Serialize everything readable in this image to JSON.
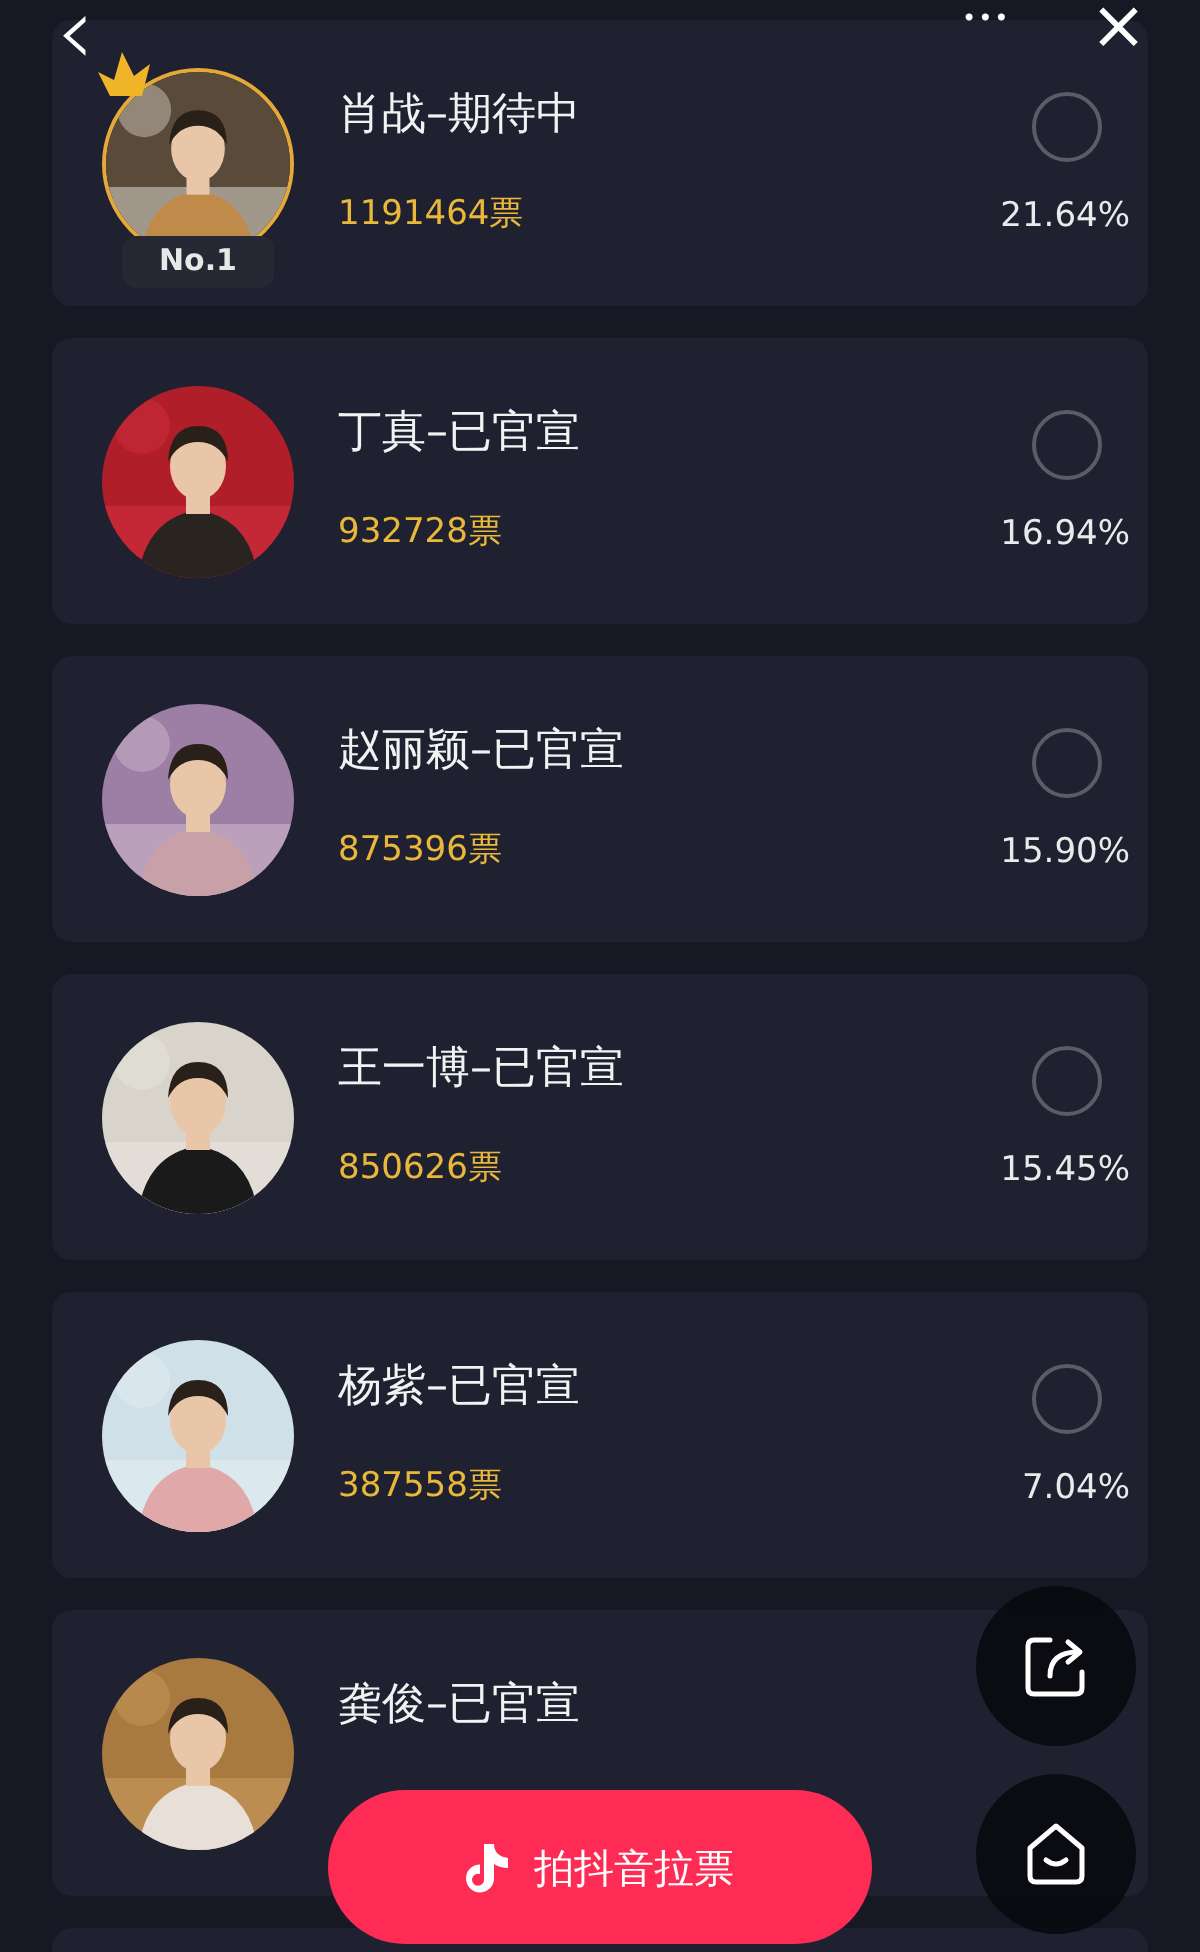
{
  "nav": {
    "back": "‹",
    "more": "•••",
    "close": "×"
  },
  "candidates": [
    {
      "name": "肖战–期待中",
      "votes": "1191464票",
      "percent": "21.64%",
      "selected": false,
      "rank": "No.1"
    },
    {
      "name": "丁真–已官宣",
      "votes": "932728票",
      "percent": "16.94%",
      "selected": false
    },
    {
      "name": "赵丽颖–已官宣",
      "votes": "875396票",
      "percent": "15.90%",
      "selected": false
    },
    {
      "name": "王一博–已官宣",
      "votes": "850626票",
      "percent": "15.45%",
      "selected": false
    },
    {
      "name": "杨紫–已官宣",
      "votes": "387558票",
      "percent": "7.04%",
      "selected": false
    },
    {
      "name": "龚俊–已官宣"
    }
  ],
  "vote_button": {
    "label": "拍抖音拉票"
  }
}
